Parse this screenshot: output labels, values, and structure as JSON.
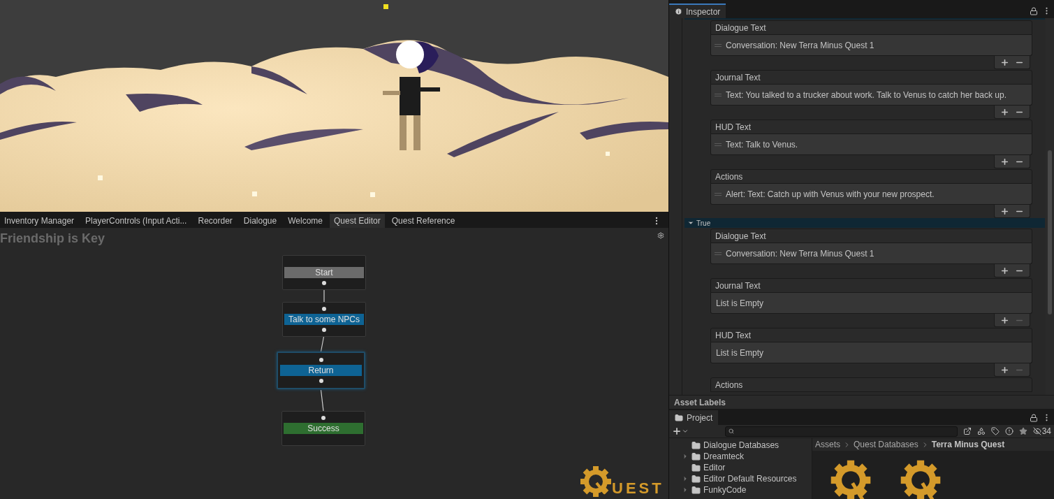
{
  "editor_tabs": [
    {
      "label": "Inventory Manager",
      "selected": false
    },
    {
      "label": "PlayerControls (Input Acti...",
      "selected": false
    },
    {
      "label": "Recorder",
      "selected": false
    },
    {
      "label": "Dialogue",
      "selected": false
    },
    {
      "label": "Welcome",
      "selected": false
    },
    {
      "label": "Quest Editor",
      "selected": true
    },
    {
      "label": "Quest Reference",
      "selected": false
    }
  ],
  "quest_editor": {
    "title": "Friendship is Key",
    "nodes": [
      {
        "label": "Start",
        "kind": "start",
        "selected": false
      },
      {
        "label": "Talk to some NPCs",
        "kind": "task",
        "selected": false
      },
      {
        "label": "Return",
        "kind": "task",
        "selected": true
      },
      {
        "label": "Success",
        "kind": "success",
        "selected": false
      }
    ],
    "logo_text": "UEST"
  },
  "inspector": {
    "title": "Inspector",
    "blocks": [
      {
        "kind": "foldout",
        "expanded": true
      },
      {
        "kind": "list",
        "title": "Dialogue Text",
        "items": [
          "Conversation: New Terra Minus Quest 1"
        ],
        "remove_disabled": false
      },
      {
        "kind": "list",
        "title": "Journal Text",
        "items": [
          "Text: You talked to a trucker about work. Talk to Venus to catch her back up."
        ],
        "remove_disabled": false
      },
      {
        "kind": "list",
        "title": "HUD Text",
        "items": [
          "Text: Talk to Venus."
        ],
        "remove_disabled": false
      },
      {
        "kind": "list",
        "title": "Actions",
        "items": [
          "Alert: Text: Catch up with Venus with your new prospect."
        ],
        "remove_disabled": false
      },
      {
        "kind": "foldout",
        "label": "True",
        "expanded": true
      },
      {
        "kind": "list",
        "title": "Dialogue Text",
        "items": [
          "Conversation: New Terra Minus Quest 1"
        ],
        "remove_disabled": false
      },
      {
        "kind": "list",
        "title": "Journal Text",
        "empty_label": "List is Empty",
        "remove_disabled": true
      },
      {
        "kind": "list",
        "title": "HUD Text",
        "empty_label": "List is Empty",
        "remove_disabled": true
      },
      {
        "kind": "header",
        "title": "Actions"
      }
    ]
  },
  "asset_labels": "Asset Labels",
  "project": {
    "title": "Project",
    "hidden_count": "34",
    "folders": [
      {
        "name": "Dialogue Databases",
        "has_children": false
      },
      {
        "name": "Dreamteck",
        "has_children": true
      },
      {
        "name": "Editor",
        "has_children": false
      },
      {
        "name": "Editor Default Resources",
        "has_children": true
      },
      {
        "name": "FunkyCode",
        "has_children": true
      }
    ],
    "breadcrumb": [
      "Assets",
      "Quest Databases",
      "Terra Minus Quest"
    ]
  }
}
